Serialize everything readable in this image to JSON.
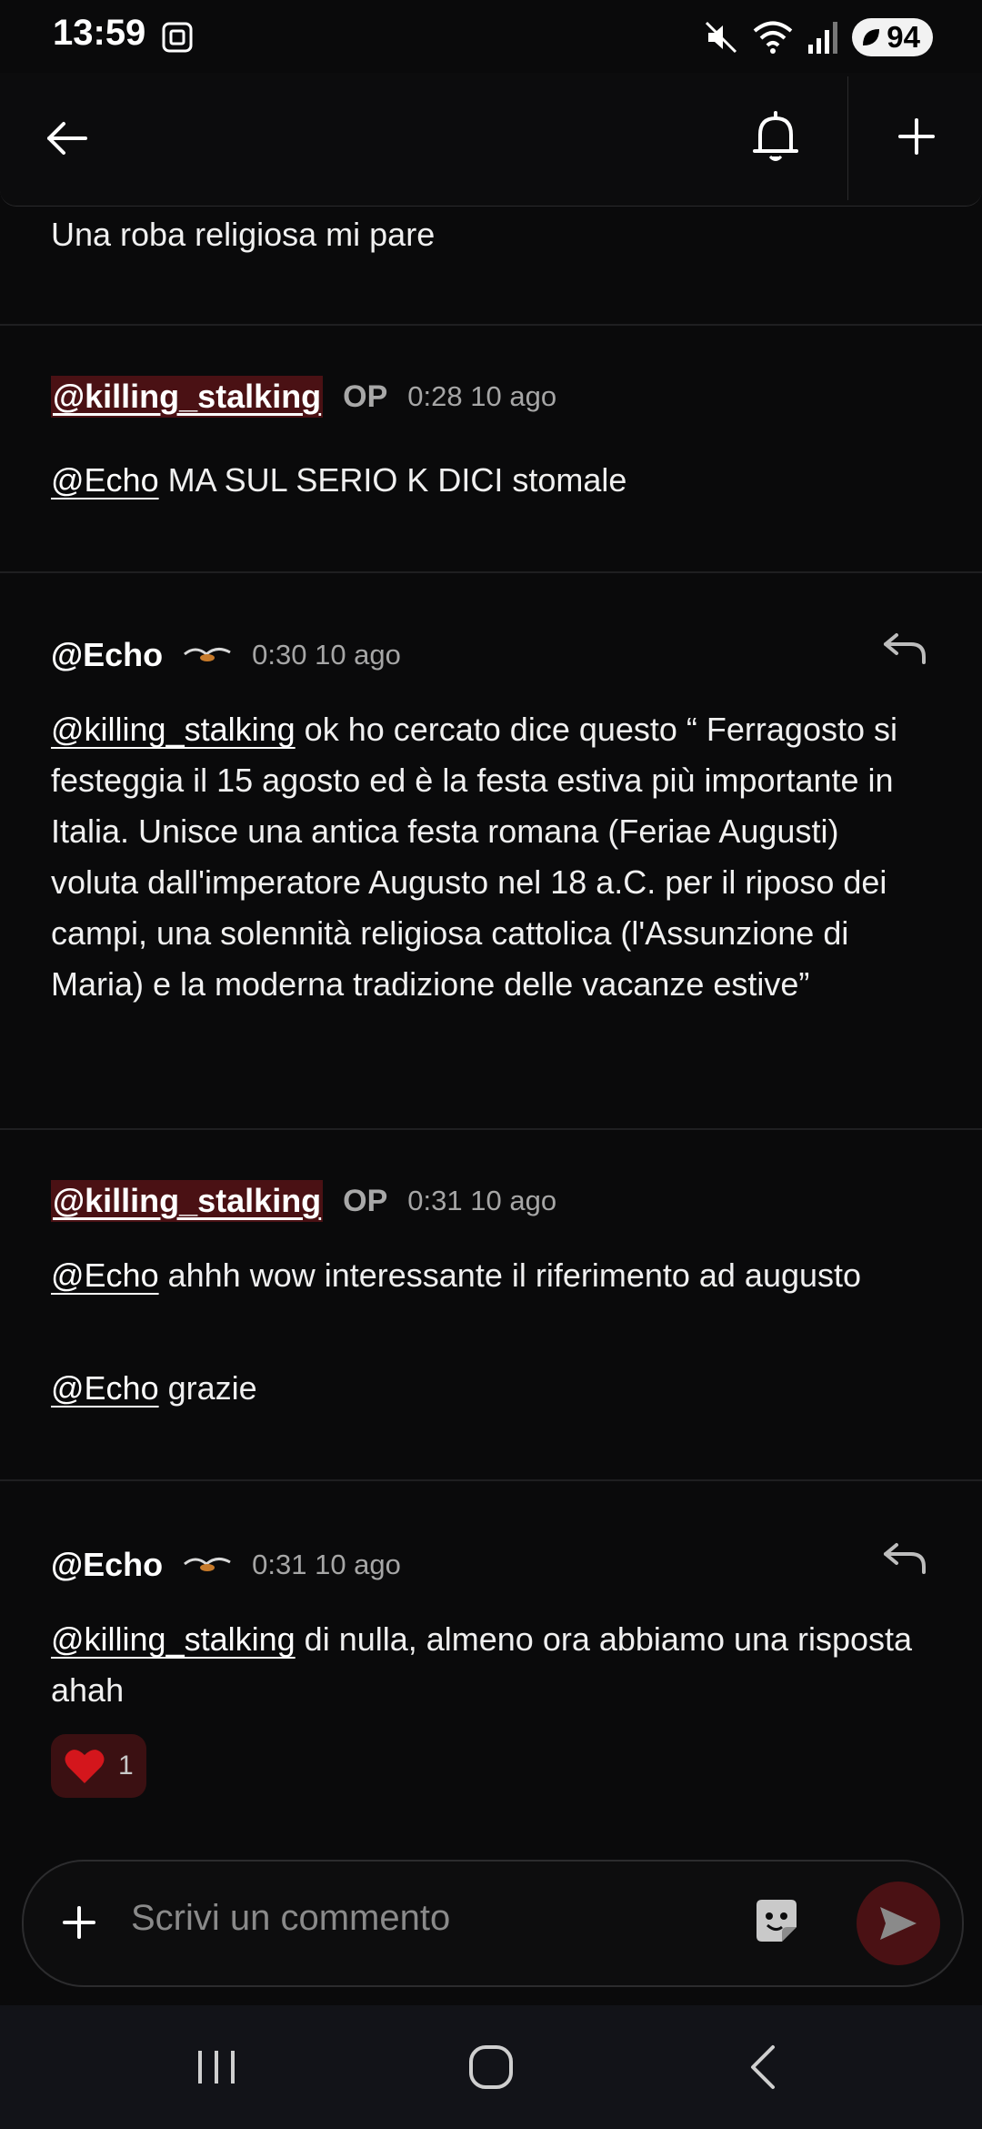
{
  "status": {
    "time": "13:59",
    "battery": "94"
  },
  "comments": [
    {
      "text": "Una roba religiosa mi pare"
    },
    {
      "user": "@killing_stalking",
      "op": "OP",
      "meta": "0:28 10 ago",
      "mention": "@Echo",
      "text": " MA SUL SERIO K DICI stomale"
    },
    {
      "user": "@Echo",
      "meta": "0:30 10 ago",
      "mention": "@killing_stalking",
      "text": " ok ho cercato dice questo “ Ferragosto si festeggia il 15 agosto ed è la festa estiva più importante in Italia. Unisce una antica festa romana (Feriae Augusti) voluta dall'imperatore Augusto nel 18 a.C. per il riposo dei campi, una solennità religiosa cattolica (l'Assunzione di Maria) e la moderna tradizione delle vacanze estive”"
    },
    {
      "user": "@killing_stalking",
      "op": "OP",
      "meta": "0:31 10 ago",
      "mention1": "@Echo",
      "text1": " ahhh wow interessante il riferimento ad augusto",
      "mention2": "@Echo",
      "text2": " grazie"
    },
    {
      "user": "@Echo",
      "meta": "0:31 10 ago",
      "mention": "@killing_stalking",
      "text": " di nulla, almeno ora abbiamo una risposta ahah",
      "reaction_count": "1"
    }
  ],
  "composer": {
    "placeholder": "Scrivi un commento"
  },
  "colors": {
    "background": "#0a0a0b",
    "op_highlight": "#4a1114",
    "heart": "#d4161c"
  },
  "icons": [
    "back-arrow-icon",
    "bell-icon",
    "plus-icon",
    "reply-icon",
    "heart-icon",
    "sticker-icon",
    "send-icon",
    "recents-icon",
    "home-icon",
    "back-nav-icon"
  ]
}
